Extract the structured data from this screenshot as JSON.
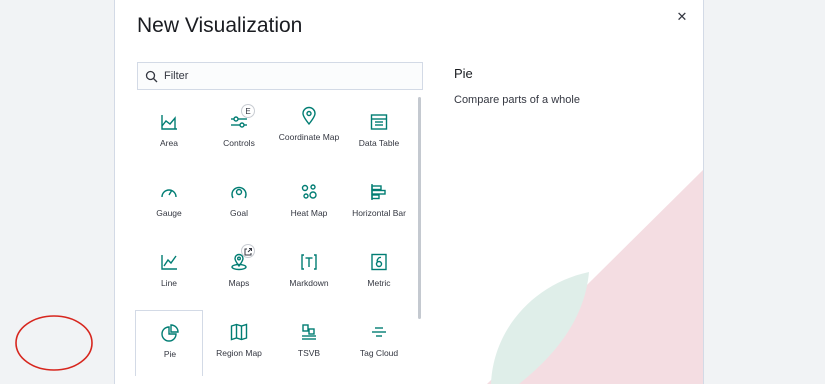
{
  "modal": {
    "title": "New Visualization",
    "close_icon": "close-icon"
  },
  "filter": {
    "placeholder": "Filter",
    "value": "",
    "icon": "search-icon"
  },
  "types": [
    {
      "label": "Area",
      "icon": "area-chart-icon"
    },
    {
      "label": "Controls",
      "icon": "controls-icon",
      "badge": "E"
    },
    {
      "label": "Coordinate Map",
      "icon": "map-pin-icon"
    },
    {
      "label": "Data Table",
      "icon": "table-icon"
    },
    {
      "label": "Gauge",
      "icon": "gauge-icon"
    },
    {
      "label": "Goal",
      "icon": "goal-icon"
    },
    {
      "label": "Heat Map",
      "icon": "heatmap-icon"
    },
    {
      "label": "Horizontal Bar",
      "icon": "horizontal-bar-icon"
    },
    {
      "label": "Line",
      "icon": "line-chart-icon"
    },
    {
      "label": "Maps",
      "icon": "maps-icon",
      "badge_icon": "external-link-icon"
    },
    {
      "label": "Markdown",
      "icon": "markdown-icon"
    },
    {
      "label": "Metric",
      "icon": "metric-icon"
    },
    {
      "label": "Pie",
      "icon": "pie-chart-icon",
      "selected": true
    },
    {
      "label": "Region Map",
      "icon": "region-map-icon"
    },
    {
      "label": "TSVB",
      "icon": "tsvb-icon"
    },
    {
      "label": "Tag Cloud",
      "icon": "tag-cloud-icon"
    }
  ],
  "detail": {
    "title": "Pie",
    "description": "Compare parts of a whole"
  },
  "colors": {
    "icon_accent": "#017d73",
    "annotation": "#d7261e",
    "deco_pink": "#f2d7dd",
    "deco_green": "#dfeee9"
  }
}
